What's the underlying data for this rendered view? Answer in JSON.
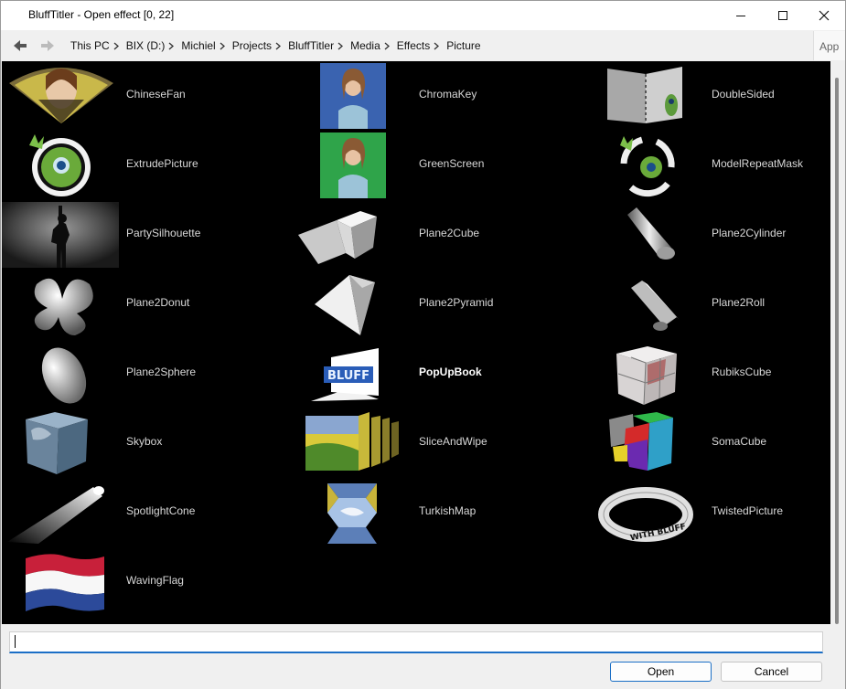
{
  "window": {
    "title": "BluffTitler - Open effect [0, 22]"
  },
  "breadcrumb": [
    {
      "label": "This PC"
    },
    {
      "label": "BIX (D:)"
    },
    {
      "label": "Michiel"
    },
    {
      "label": "Projects"
    },
    {
      "label": "BluffTitler"
    },
    {
      "label": "Media"
    },
    {
      "label": "Effects"
    },
    {
      "label": "Picture"
    }
  ],
  "app_tab": "App",
  "items": [
    {
      "label": "ChineseFan"
    },
    {
      "label": "ChromaKey"
    },
    {
      "label": "DoubleSided"
    },
    {
      "label": "ExtrudePicture"
    },
    {
      "label": "GreenScreen"
    },
    {
      "label": "ModelRepeatMask"
    },
    {
      "label": "PartySilhouette"
    },
    {
      "label": "Plane2Cube"
    },
    {
      "label": "Plane2Cylinder"
    },
    {
      "label": "Plane2Donut"
    },
    {
      "label": "Plane2Pyramid"
    },
    {
      "label": "Plane2Roll"
    },
    {
      "label": "Plane2Sphere"
    },
    {
      "label": "PopUpBook"
    },
    {
      "label": "RubiksCube"
    },
    {
      "label": "Skybox"
    },
    {
      "label": "SliceAndWipe"
    },
    {
      "label": "SomaCube"
    },
    {
      "label": "SpotlightCone"
    },
    {
      "label": "TurkishMap"
    },
    {
      "label": "TwistedPicture"
    },
    {
      "label": "WavingFlag"
    }
  ],
  "thumb_text": {
    "popup": "BLUFF",
    "twisted": "WITH BLUFF"
  },
  "filename": {
    "value": ""
  },
  "buttons": {
    "open": "Open",
    "cancel": "Cancel"
  }
}
